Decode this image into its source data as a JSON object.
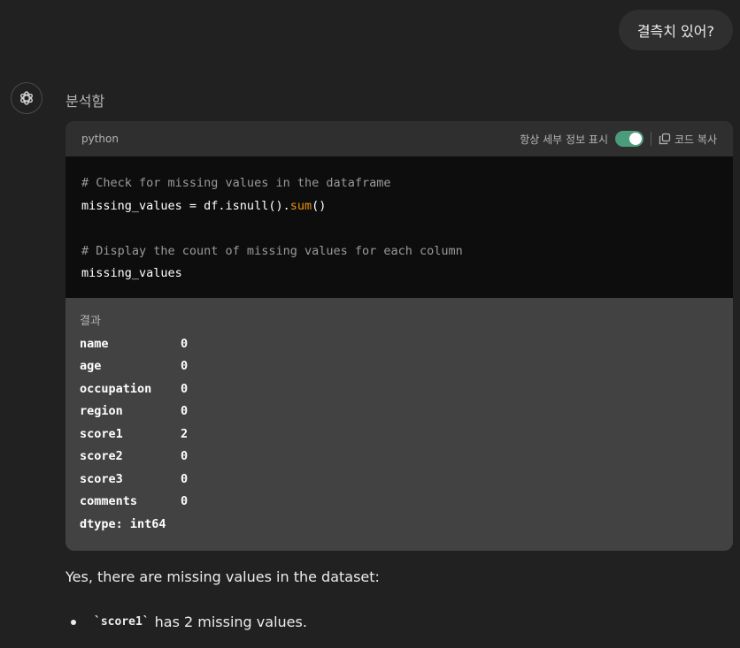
{
  "user_message": "결측치 있어?",
  "assistant": {
    "status": "분석함",
    "code_block": {
      "language": "python",
      "toggle_label": "항상 세부 정보 표시",
      "toggle_on": true,
      "copy_label": "코드 복사",
      "lines": {
        "comment1": "# Check for missing values in the dataframe",
        "line2_pre": "missing_values = df.isnull().",
        "line2_fn": "sum",
        "line2_post": "()",
        "comment2": "# Display the count of missing values for each column",
        "line4": "missing_values"
      }
    },
    "result": {
      "label": "결과",
      "rows": [
        {
          "key": "name",
          "value": "0"
        },
        {
          "key": "age",
          "value": "0"
        },
        {
          "key": "occupation",
          "value": "0"
        },
        {
          "key": "region",
          "value": "0"
        },
        {
          "key": "score1",
          "value": "2"
        },
        {
          "key": "score2",
          "value": "0"
        },
        {
          "key": "score3",
          "value": "0"
        },
        {
          "key": "comments",
          "value": "0"
        }
      ],
      "dtype": "dtype: int64"
    },
    "answer_text": "Yes, there are missing values in the dataset:",
    "bullets": [
      {
        "code": "`score1`",
        "text": "has 2 missing values."
      }
    ]
  },
  "colors": {
    "background": "#212121",
    "bubble": "#2f2f2f",
    "code_bg": "#0d0d0d",
    "result_bg": "#424242",
    "toggle_on": "#4a9c7a",
    "function_color": "#e9950c"
  }
}
